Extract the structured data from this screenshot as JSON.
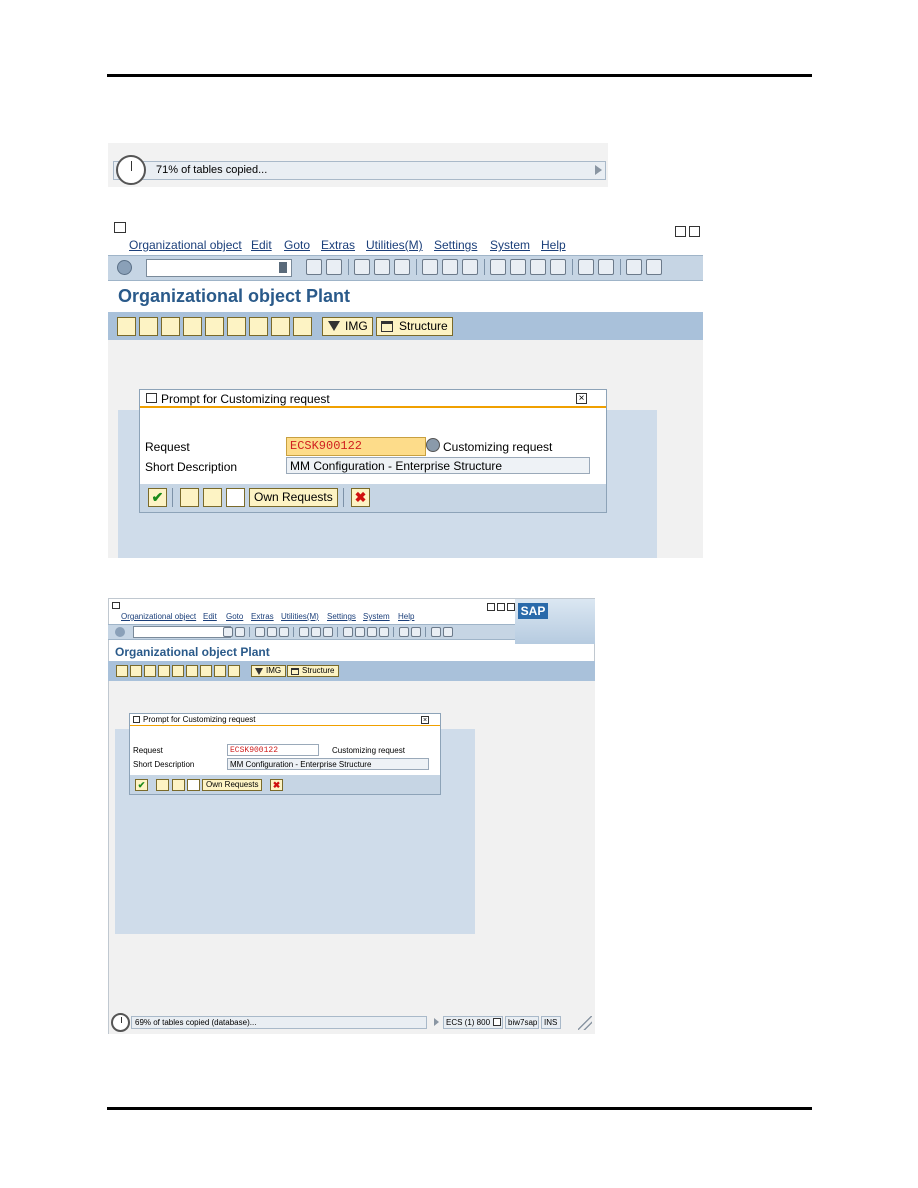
{
  "progress_strip": {
    "text": "71% of tables copied...",
    "stopwatch_icon": "stopwatch-icon",
    "expand_icon": "triangle-right-icon"
  },
  "large": {
    "menu": [
      "Organizational object",
      "Edit",
      "Goto",
      "Extras",
      "Utilities(M)",
      "Settings",
      "System",
      "Help"
    ],
    "title": "Organizational object Plant",
    "app_toolbar": {
      "img_label": "IMG",
      "structure_label": "Structure"
    },
    "dialog": {
      "title": "Prompt for Customizing request",
      "request_label": "Request",
      "request_value": "ECSK900122",
      "request_type": "Customizing request",
      "short_desc_label": "Short Description",
      "short_desc_value": "MM Configuration - Enterprise Structure",
      "own_requests_label": "Own Requests"
    }
  },
  "small": {
    "menu": [
      "Organizational object",
      "Edit",
      "Goto",
      "Extras",
      "Utilities(M)",
      "Settings",
      "System",
      "Help"
    ],
    "logo": "SAP",
    "title": "Organizational object Plant",
    "app_toolbar": {
      "img_label": "IMG",
      "structure_label": "Structure"
    },
    "dialog": {
      "title": "Prompt for Customizing request",
      "request_label": "Request",
      "request_value": "ECSK900122",
      "request_type": "Customizing request",
      "short_desc_label": "Short Description",
      "short_desc_value": "MM Configuration - Enterprise Structure",
      "own_requests_label": "Own Requests"
    },
    "status": {
      "text": "69% of tables copied (database)...",
      "system": "ECS (1) 800",
      "server": "biw7sap",
      "mode": "INS"
    }
  },
  "colors": {
    "accent_orange": "#f0a000",
    "title_blue": "#2a5a8a",
    "toolbar_blue": "#a9c1da",
    "request_red": "#d02020"
  }
}
